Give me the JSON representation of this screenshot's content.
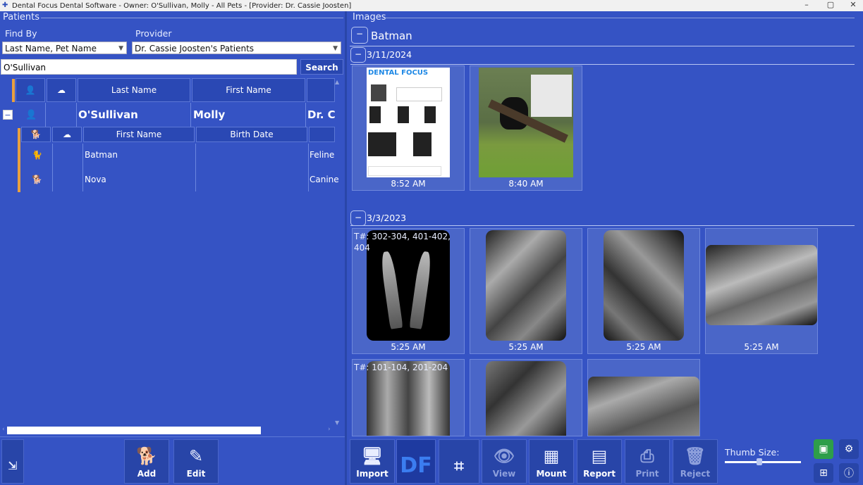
{
  "window": {
    "title": "Dental Focus Dental Software - Owner: O'Sullivan, Molly - All Pets - [Provider: Dr. Cassie Joosten]"
  },
  "patients_panel": {
    "label": "Patients",
    "find_by": {
      "label": "Find By",
      "value": "Last Name, Pet Name"
    },
    "provider": {
      "label": "Provider",
      "value": "Dr. Cassie Joosten's Patients"
    },
    "search": {
      "value": "O'Sullivan",
      "button": "Search"
    },
    "owner_columns": [
      "Last Name",
      "First Name"
    ],
    "owner_row": {
      "last_name": "O'Sullivan",
      "first_name": "Molly",
      "provider": "Dr. C"
    },
    "pet_columns": [
      "First Name",
      "Birth Date"
    ],
    "pets": [
      {
        "name": "Batman",
        "species": "Feline"
      },
      {
        "name": "Nova",
        "species": "Canine"
      }
    ],
    "buttons": {
      "add": "Add",
      "edit": "Edit"
    }
  },
  "images_panel": {
    "label": "Images",
    "pet_name": "Batman",
    "groups": [
      {
        "date": "3/11/2024",
        "times": [
          "8:52 AM",
          "8:40 AM"
        ]
      },
      {
        "date": "3/3/2023",
        "tooth_label_1": "T#: 302-304, 401-402,",
        "tooth_label_1b": "404",
        "times": [
          "5:25 AM",
          "5:25 AM",
          "5:25 AM",
          "5:25 AM"
        ],
        "tooth_label_2": "T#: 101-104, 201-204"
      }
    ],
    "report_doc_header": "DENTAL FOCUS"
  },
  "toolbar": {
    "import": "Import",
    "view": "View",
    "mount": "Mount",
    "report": "Report",
    "print": "Print",
    "reject": "Reject",
    "thumb_size": "Thumb Size:"
  }
}
